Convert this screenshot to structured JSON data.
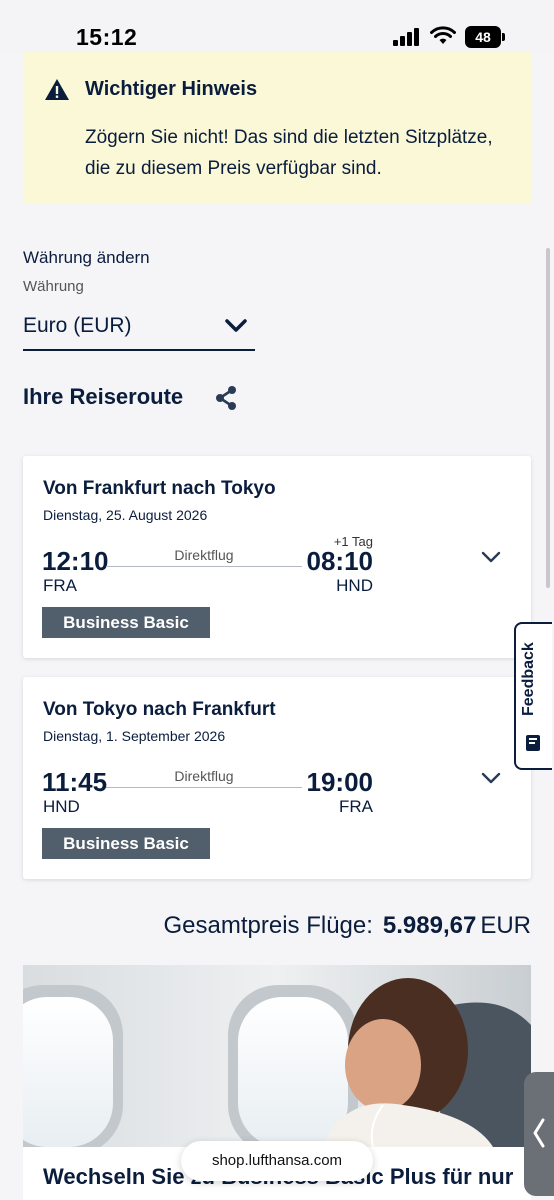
{
  "status_bar": {
    "time": "15:12",
    "battery": "48"
  },
  "notice": {
    "title": "Wichtiger Hinweis",
    "text": "Zögern Sie nicht! Das sind die letzten Sitzplätze, die zu diesem Preis verfügbar sind."
  },
  "currency": {
    "heading": "Währung ändern",
    "label": "Währung",
    "value": "Euro (EUR)"
  },
  "itinerary": {
    "title": "Ihre Reiseroute",
    "flights": [
      {
        "title": "Von Frankfurt nach Tokyo",
        "date": "Dienstag, 25. August 2026",
        "departure_time": "12:10",
        "departure_code": "FRA",
        "arrival_time": "08:10",
        "arrival_code": "HND",
        "day_offset": "+1 Tag",
        "type": "Direktflug",
        "fare": "Business Basic"
      },
      {
        "title": "Von Tokyo nach Frankfurt",
        "date": "Dienstag, 1. September 2026",
        "departure_time": "11:45",
        "departure_code": "HND",
        "arrival_time": "19:00",
        "arrival_code": "FRA",
        "type": "Direktflug",
        "fare": "Business Basic"
      }
    ]
  },
  "feedback": {
    "label": "Feedback"
  },
  "total": {
    "label": "Gesamtpreis Flüge:",
    "value": "5.989,67",
    "currency": "EUR"
  },
  "promo": {
    "text": "Wechseln Sie zu Business Basic Plus für nur"
  },
  "browser": {
    "url": "shop.lufthansa.com"
  },
  "colors": {
    "primary": "#0a1d3d",
    "notice_bg": "#fbf8d7",
    "fare_badge": "#505f6b",
    "page_bg": "#f5f5f7"
  },
  "icons": [
    "warning-icon",
    "chevron-down-icon",
    "share-icon",
    "feedback-icon",
    "chevron-left-icon"
  ]
}
